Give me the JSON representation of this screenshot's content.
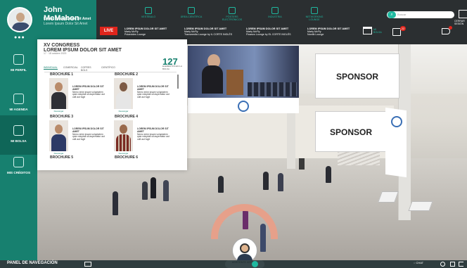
{
  "user": {
    "name": "John McMahon",
    "line1": "Lorem Ipsum Dolor Sit Amet",
    "line2": "Lorem Ipsum Dolor Sit Amet"
  },
  "top_nav": [
    "VESTÍBULO",
    "ÁREA CIENTÍFICA",
    "PÓSTERS ELECTRÓNICOS",
    "INDUSTRIA",
    "NETWORKING LOUNGE"
  ],
  "live_label": "LIVE",
  "events": [
    {
      "title": "LOREM IPSUM DOLOR SIT AMET",
      "speaker": "Marty McFly",
      "room": "Polaroides Lounge"
    },
    {
      "title": "LOREM IPSUM DOLOR SIT AMET",
      "speaker": "Marty McFly",
      "room": "Transmedia Lounge by IL CORTE INGLÉS"
    },
    {
      "title": "LOREM IPSUM DOLOR SIT AMET",
      "speaker": "Marty McFly",
      "room": "Finanzo Lounge by EL CORTE INGLÉS"
    },
    {
      "title": "LOREM IPSUM DOLOR SIT AMET",
      "speaker": "Marty McFly",
      "room": "Nordik Lounge"
    }
  ],
  "search_placeholder": "Buscar",
  "top_right": {
    "mi_bolsa": "MI BOLSA",
    "bag_count": "22",
    "cerrar": "CERRAR SESIÓN"
  },
  "sidebar": [
    {
      "label": "MI PERFIL"
    },
    {
      "label": "MI AGENDA"
    },
    {
      "label": "MI BOLSA"
    },
    {
      "label": "MIS CRÉDITOS"
    }
  ],
  "panel": {
    "congress": "XV CONGRESS",
    "title": "LOREM IPSUM DOLOR SIT AMET",
    "date": "17 · 18 octubre 2023",
    "count": "127",
    "count_label": "ELEMENTOS EN LA BOLSA",
    "tabs": [
      "INDIVIDUAL",
      "COMERCIAL",
      "COFRES BOLS",
      "CIENTÍFICO"
    ],
    "cards": [
      {
        "title": "BROCHURE 1",
        "heading": "LOREM IPSUM DOLOR SIT AMET",
        "body": "Nemo enim ipsam voluptatem quia voluptas sit aspernatur aut odit aut fugit",
        "download": "Descargar"
      },
      {
        "title": "BROCHURE 2",
        "heading": "LOREM IPSUM DOLOR SIT AMET",
        "body": "Nemo enim ipsam voluptatem quia voluptas sit aspernatur aut odit aut fugit",
        "download": "Descargar"
      },
      {
        "title": "BROCHURE 3",
        "heading": "LOREM IPSUM DOLOR SIT AMET",
        "body": "Nemo enim ipsam voluptatem quia voluptas sit aspernatur aut odit aut fugit",
        "download": "Descargar"
      },
      {
        "title": "BROCHURE 4",
        "heading": "LOREM IPSUM DOLOR SIT AMET",
        "body": "Nemo enim ipsam voluptatem quia voluptas sit aspernatur aut odit aut fugit",
        "download": "Descargar"
      },
      {
        "title": "BROCHURE 5",
        "heading": "",
        "body": "",
        "download": ""
      },
      {
        "title": "BROCHURE 6",
        "heading": "",
        "body": "",
        "download": ""
      }
    ]
  },
  "sponsors": [
    "SPONSOR",
    "SPONSOR"
  ],
  "bottom": {
    "nav_label": "PANEL DE NAVEGACIÓN",
    "chat": "CHAT",
    "assistant": "ASISTENTE VIRTUAL"
  },
  "colors": {
    "brand": "#17806f",
    "accent": "#1fb9a0",
    "live": "#e0251c"
  }
}
